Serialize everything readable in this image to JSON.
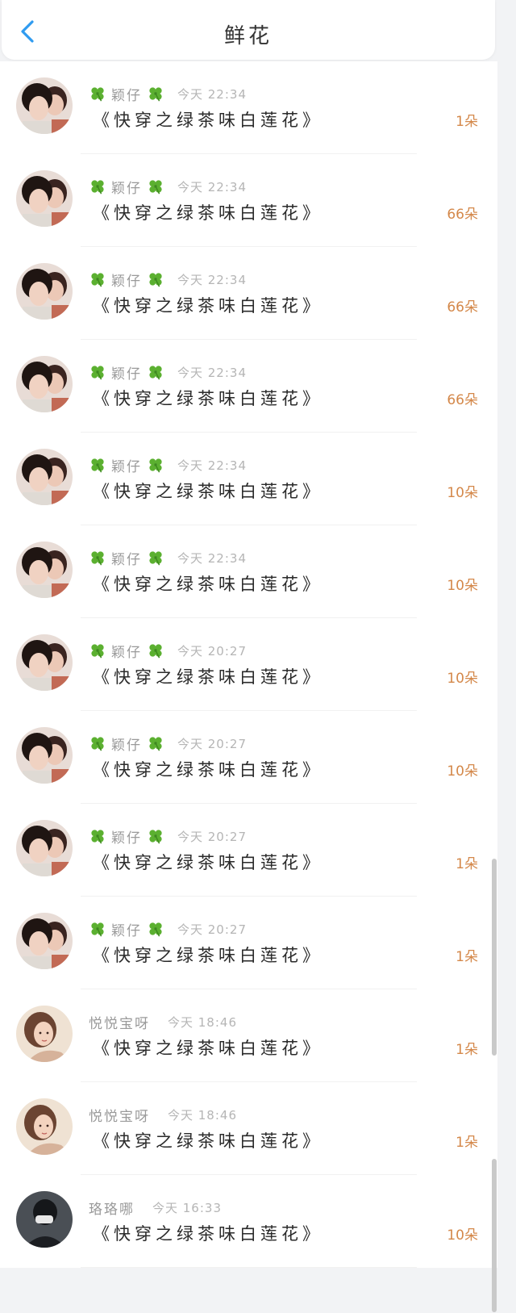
{
  "header": {
    "title": "鲜花",
    "back_icon": "chevron-left-icon",
    "accent_color": "#2f9bf0"
  },
  "entries": [
    {
      "name": "颖仔",
      "time": "今天 22:34",
      "book": "《快穿之绿茶味白莲花》",
      "count": "1朵",
      "avatar": "couple-photo",
      "leaf_icons": true
    },
    {
      "name": "颖仔",
      "time": "今天 22:34",
      "book": "《快穿之绿茶味白莲花》",
      "count": "66朵",
      "avatar": "couple-photo",
      "leaf_icons": true
    },
    {
      "name": "颖仔",
      "time": "今天 22:34",
      "book": "《快穿之绿茶味白莲花》",
      "count": "66朵",
      "avatar": "couple-photo",
      "leaf_icons": true
    },
    {
      "name": "颖仔",
      "time": "今天 22:34",
      "book": "《快穿之绿茶味白莲花》",
      "count": "66朵",
      "avatar": "couple-photo",
      "leaf_icons": true
    },
    {
      "name": "颖仔",
      "time": "今天 22:34",
      "book": "《快穿之绿茶味白莲花》",
      "count": "10朵",
      "avatar": "couple-photo",
      "leaf_icons": true
    },
    {
      "name": "颖仔",
      "time": "今天 22:34",
      "book": "《快穿之绿茶味白莲花》",
      "count": "10朵",
      "avatar": "couple-photo",
      "leaf_icons": true
    },
    {
      "name": "颖仔",
      "time": "今天 20:27",
      "book": "《快穿之绿茶味白莲花》",
      "count": "10朵",
      "avatar": "couple-photo",
      "leaf_icons": true
    },
    {
      "name": "颖仔",
      "time": "今天 20:27",
      "book": "《快穿之绿茶味白莲花》",
      "count": "10朵",
      "avatar": "couple-photo",
      "leaf_icons": true
    },
    {
      "name": "颖仔",
      "time": "今天 20:27",
      "book": "《快穿之绿茶味白莲花》",
      "count": "1朵",
      "avatar": "couple-photo",
      "leaf_icons": true
    },
    {
      "name": "颖仔",
      "time": "今天 20:27",
      "book": "《快穿之绿茶味白莲花》",
      "count": "1朵",
      "avatar": "couple-photo",
      "leaf_icons": true
    },
    {
      "name": "悦悦宝呀",
      "time": "今天 18:46",
      "book": "《快穿之绿茶味白莲花》",
      "count": "1朵",
      "avatar": "illustrated-woman",
      "leaf_icons": false
    },
    {
      "name": "悦悦宝呀",
      "time": "今天 18:46",
      "book": "《快穿之绿茶味白莲花》",
      "count": "1朵",
      "avatar": "illustrated-woman",
      "leaf_icons": false
    },
    {
      "name": "珞珞哪",
      "time": "今天 16:33",
      "book": "《快穿之绿茶味白莲花》",
      "count": "10朵",
      "avatar": "dark-masked-figure",
      "leaf_icons": false
    }
  ],
  "colors": {
    "count": "#d4884a",
    "leaf": "#5bb030",
    "name": "#9a9a9a",
    "time": "#b5b5b5",
    "book": "#2a2a2a"
  }
}
